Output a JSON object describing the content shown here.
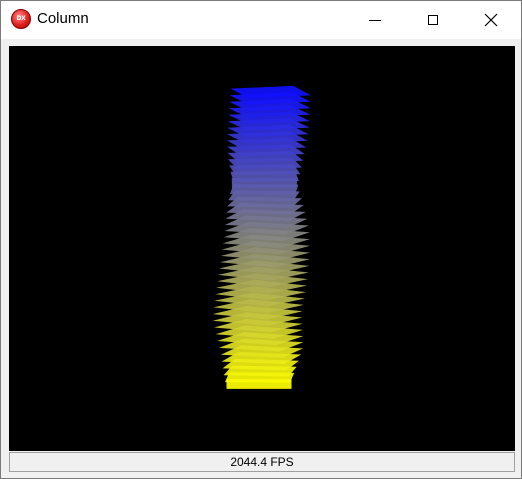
{
  "window": {
    "title": "Column",
    "icon": "dx-app-icon",
    "icon_label": "DX",
    "controls": {
      "minimize_icon": "minimize-icon",
      "maximize_icon": "maximize-icon",
      "close_icon": "close-icon"
    }
  },
  "viewport": {
    "background_color": "#000000",
    "column": {
      "shape": "twisted-square-column",
      "top_color": "#1010ff",
      "bottom_color": "#ffff00"
    }
  },
  "status": {
    "fps_text": "2044.4 FPS"
  }
}
